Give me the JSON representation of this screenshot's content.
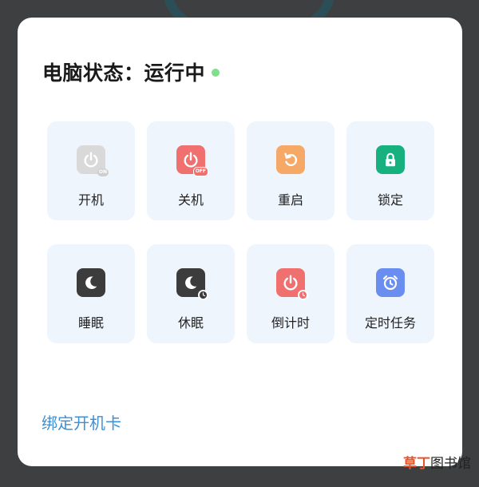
{
  "status": {
    "title": "电脑状态：运行中",
    "dot_color": "#7ee08a"
  },
  "actions": [
    {
      "label": "开机",
      "icon": "power-on-icon",
      "color": "#d9d9d9",
      "badge": "ON",
      "badge_color": "#cfcfcf"
    },
    {
      "label": "关机",
      "icon": "power-off-icon",
      "color": "#f07070",
      "badge": "OFF",
      "badge_color": "#f07070"
    },
    {
      "label": "重启",
      "icon": "restart-icon",
      "color": "#f6a866"
    },
    {
      "label": "锁定",
      "icon": "lock-icon",
      "color": "#17b07f"
    },
    {
      "label": "睡眠",
      "icon": "moon-icon",
      "color": "#3c3c3c"
    },
    {
      "label": "休眠",
      "icon": "moon-clock-icon",
      "color": "#3c3c3c"
    },
    {
      "label": "倒计时",
      "icon": "power-timer-icon",
      "color": "#f07070"
    },
    {
      "label": "定时任务",
      "icon": "alarm-clock-icon",
      "color": "#6a8df0"
    }
  ],
  "bind_card_link": "绑定开机卡",
  "watermark": {
    "part1": "草丁",
    "part2": "图书馆"
  }
}
